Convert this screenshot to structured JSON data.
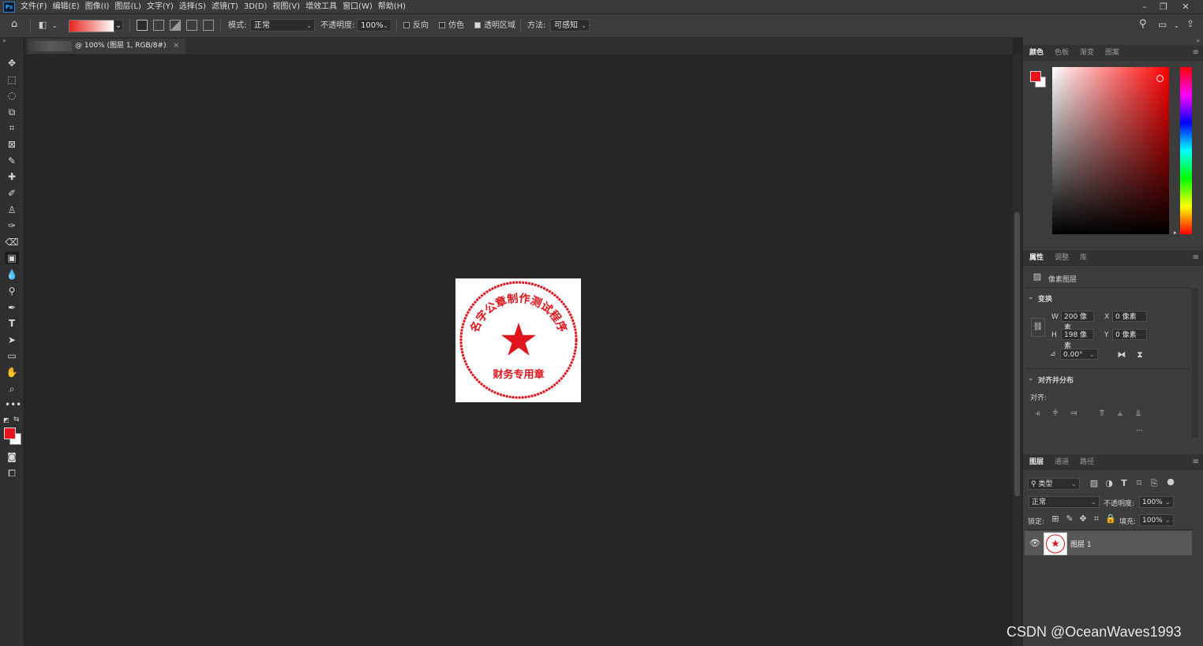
{
  "app": {
    "logo": "Ps",
    "menu": [
      "文件(F)",
      "编辑(E)",
      "图像(I)",
      "图层(L)",
      "文字(Y)",
      "选择(S)",
      "滤镜(T)",
      "3D(D)",
      "视图(V)",
      "增效工具",
      "窗口(W)",
      "帮助(H)"
    ],
    "window_controls": [
      "minimize-icon",
      "restore-icon",
      "close-icon"
    ]
  },
  "options": {
    "mode_label": "模式:",
    "mode_value": "正常",
    "opacity_label": "不透明度:",
    "opacity_value": "100%",
    "reverse_label": "反向",
    "dither_label": "仿色",
    "transparency_label": "透明区域",
    "method_label": "方法:",
    "method_value": "可感知",
    "reverse_checked": false,
    "dither_checked": false,
    "transparency_checked": true,
    "gradient_from": "#e8231c",
    "gradient_to": "#ffffff"
  },
  "document": {
    "tab_title": "@ 100% (图层 1, RGB/8#)",
    "tab_close": "×",
    "seal": {
      "top_text": "名字公章制作测试程序",
      "bottom_text": "财务专用章",
      "color": "#e0141c"
    }
  },
  "colors": {
    "foreground": "#e8141c",
    "background": "#ffffff"
  },
  "color_panel": {
    "tabs": [
      "颜色",
      "色板",
      "渐变",
      "图案"
    ],
    "hue": "#ff0000"
  },
  "properties_panel": {
    "tabs": [
      "属性",
      "调整",
      "库"
    ],
    "layer_kind": "像素图层",
    "transform_title": "变换",
    "w_label": "W",
    "w_value": "200 像素",
    "h_label": "H",
    "h_value": "198 像素",
    "x_label": "X",
    "x_value": "0 像素",
    "y_label": "Y",
    "y_value": "0 像素",
    "angle_value": "0.00°",
    "align_title": "对齐并分布",
    "align_label": "对齐:",
    "more": "..."
  },
  "layers_panel": {
    "tabs": [
      "图层",
      "通道",
      "路径"
    ],
    "filter_label": "类型",
    "blend_mode": "正常",
    "opacity_label": "不透明度:",
    "opacity_value": "100%",
    "lock_label": "锁定:",
    "fill_label": "填充:",
    "fill_value": "100%",
    "layers": [
      {
        "name": "图层 1",
        "visible": true
      }
    ]
  },
  "watermark": "CSDN @OceanWaves1993"
}
